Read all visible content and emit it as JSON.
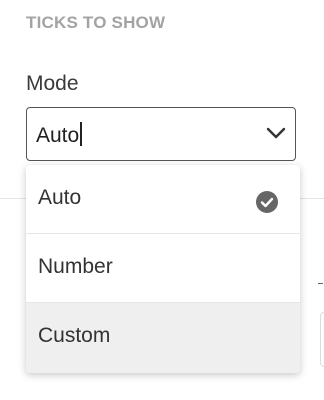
{
  "section": {
    "title": "TICKS TO SHOW"
  },
  "mode_field": {
    "label": "Mode",
    "value": "Auto"
  },
  "dropdown": {
    "options": [
      {
        "label": "Auto",
        "selected": true,
        "highlighted": false
      },
      {
        "label": "Number",
        "selected": false,
        "highlighted": false
      },
      {
        "label": "Custom",
        "selected": false,
        "highlighted": true
      }
    ]
  },
  "icons": {
    "chevron": "chevron-down-icon",
    "check": "check-circle-icon"
  },
  "colors": {
    "section_title": "#a3a3a3",
    "highlight_bg": "#efefef",
    "check_icon": "#666666"
  }
}
